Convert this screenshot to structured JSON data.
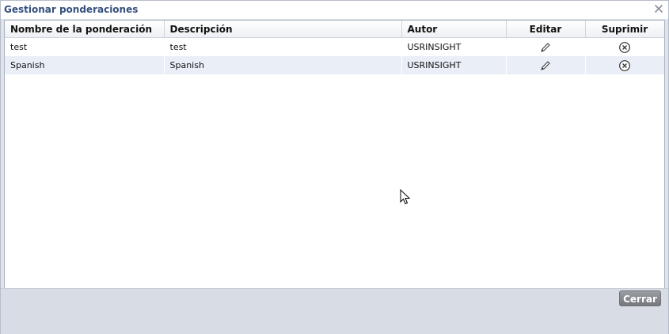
{
  "dialog": {
    "title": "Gestionar ponderaciones"
  },
  "table": {
    "columns": [
      "Nombre de la ponderación",
      "Descripción",
      "Autor",
      "Editar",
      "Suprimir"
    ],
    "rows": [
      {
        "name": "test",
        "description": "test",
        "author": "USRINSIGHT"
      },
      {
        "name": "Spanish",
        "description": "Spanish",
        "author": "USRINSIGHT"
      }
    ]
  },
  "footer": {
    "close_label": "Cerrar"
  },
  "icons": {
    "close": "close-icon",
    "edit": "pencil-icon",
    "delete": "circle-x-icon",
    "cursor": "mouse-pointer-icon"
  }
}
